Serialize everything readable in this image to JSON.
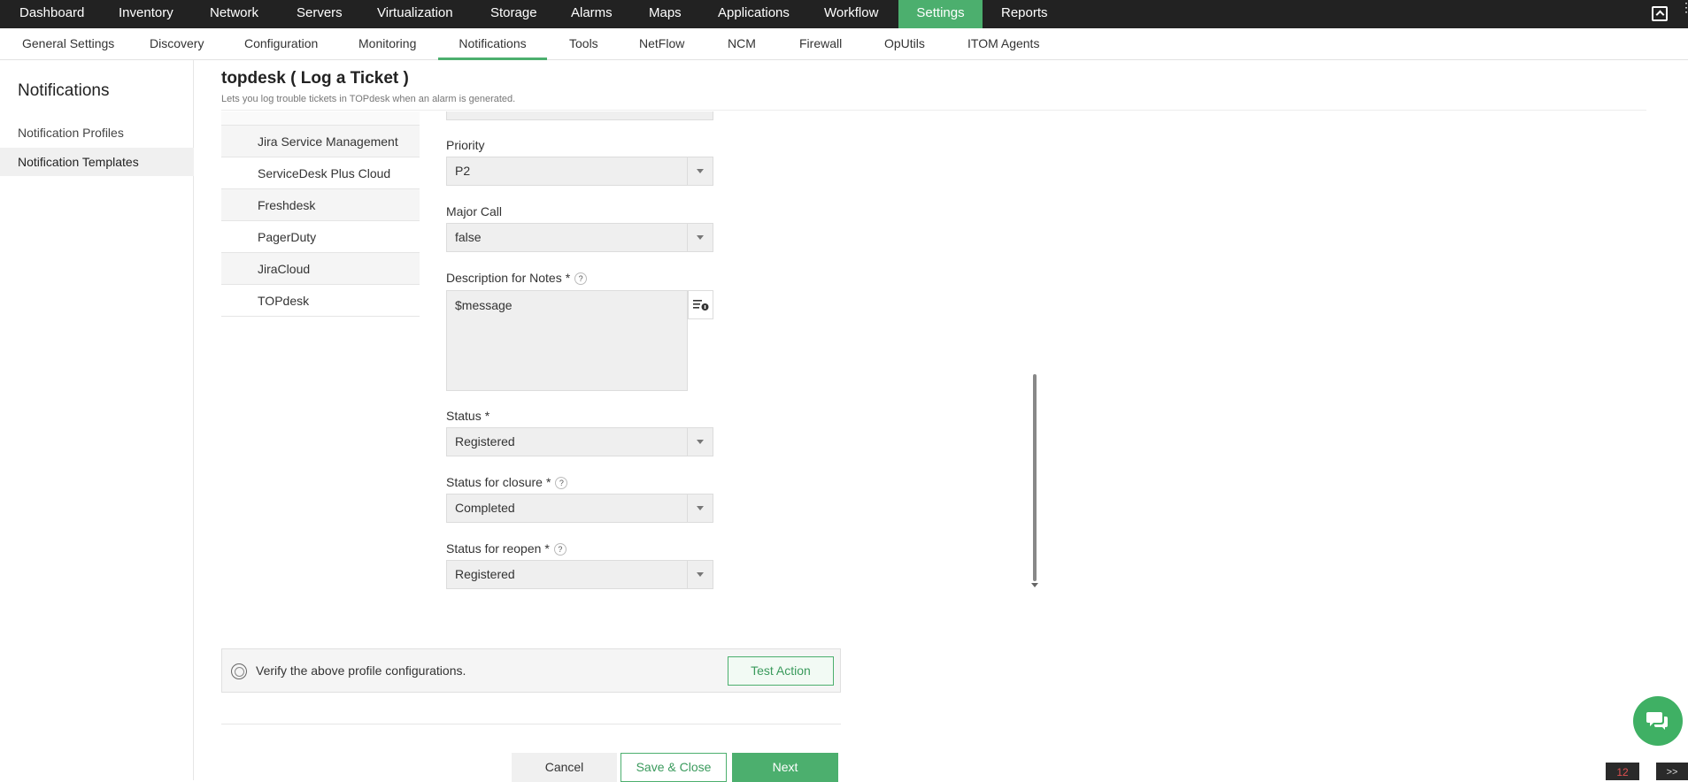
{
  "topnav": {
    "items": [
      "Dashboard",
      "Inventory",
      "Network",
      "Servers",
      "Virtualization",
      "Storage",
      "Alarms",
      "Maps",
      "Applications",
      "Workflow",
      "Settings",
      "Reports"
    ],
    "active": "Settings",
    "window_icon": "window-icon",
    "more_icon": "more-vertical-icon"
  },
  "subnav": {
    "items": [
      "General Settings",
      "Discovery",
      "Configuration",
      "Monitoring",
      "Notifications",
      "Tools",
      "NetFlow",
      "NCM",
      "Firewall",
      "OpUtils",
      "ITOM Agents"
    ],
    "active": "Notifications"
  },
  "sidebar": {
    "title": "Notifications",
    "links": [
      "Notification Profiles",
      "Notification Templates"
    ],
    "active": "Notification Templates"
  },
  "page": {
    "title": "topdesk ( Log a Ticket )",
    "subtitle": "Lets you log trouble tickets in TOPdesk when an alarm is generated."
  },
  "template_list": {
    "items": [
      "Jira Service Management",
      "ServiceDesk Plus Cloud",
      "Freshdesk",
      "PagerDuty",
      "JiraCloud",
      "TOPdesk"
    ],
    "selected": "TOPdesk"
  },
  "form": {
    "priority": {
      "label": "Priority",
      "value": "P2"
    },
    "major_call": {
      "label": "Major Call",
      "value": "false"
    },
    "description": {
      "label": "Description for Notes",
      "required": "*",
      "help": "?",
      "value": "$message"
    },
    "status": {
      "label": "Status",
      "required": "*",
      "value": "Registered"
    },
    "status_closure": {
      "label": "Status for closure",
      "required": "*",
      "help": "?",
      "value": "Completed"
    },
    "status_reopen": {
      "label": "Status for reopen",
      "required": "*",
      "help": "?",
      "value": "Registered"
    }
  },
  "verify": {
    "text": "Verify the above profile configurations.",
    "test_button": "Test Action"
  },
  "footer": {
    "cancel": "Cancel",
    "save_close": "Save & Close",
    "next": "Next"
  },
  "corner": {
    "badge": "12",
    "collapse": ">>"
  },
  "colors": {
    "accent": "#4caf6e",
    "topbar": "#222222"
  }
}
